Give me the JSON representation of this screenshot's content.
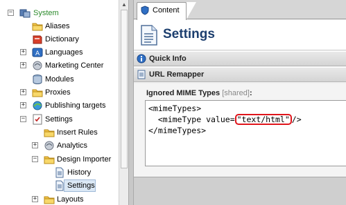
{
  "tree": {
    "items": [
      {
        "label": "System",
        "icon": "system-icon",
        "expander": "−"
      },
      {
        "label": "Aliases",
        "icon": "folder-icon",
        "expander": ""
      },
      {
        "label": "Dictionary",
        "icon": "dictionary-icon",
        "expander": ""
      },
      {
        "label": "Languages",
        "icon": "languages-icon",
        "expander": "+"
      },
      {
        "label": "Marketing Center",
        "icon": "marketing-center-icon",
        "expander": "+"
      },
      {
        "label": "Modules",
        "icon": "modules-icon",
        "expander": ""
      },
      {
        "label": "Proxies",
        "icon": "folder-icon",
        "expander": "+"
      },
      {
        "label": "Publishing targets",
        "icon": "publishing-targets-icon",
        "expander": "+"
      },
      {
        "label": "Settings",
        "icon": "settings-icon",
        "expander": "−"
      },
      {
        "label": "Insert Rules",
        "icon": "folder-icon",
        "expander": ""
      },
      {
        "label": "Analytics",
        "icon": "analytics-icon",
        "expander": "+"
      },
      {
        "label": "Design Importer",
        "icon": "folder-icon",
        "expander": "−"
      },
      {
        "label": "History",
        "icon": "document-icon",
        "expander": ""
      },
      {
        "label": "Settings",
        "icon": "document-icon",
        "expander": ""
      },
      {
        "label": "Layouts",
        "icon": "folder-icon",
        "expander": "+"
      }
    ]
  },
  "content": {
    "tab_label": "Content",
    "page_title": "Settings",
    "sections": {
      "quick_info": "Quick Info",
      "url_remapper": "URL Remapper"
    },
    "field": {
      "label": "Ignored MIME Types",
      "shared_tag": "[shared]",
      "colon": ":",
      "lines": {
        "l1": "<mimeTypes>",
        "l2_prefix": "  <mimeType value=",
        "l2_highlight": "\"text/html\"",
        "l2_suffix": "/>",
        "l3": "</mimeTypes>"
      }
    }
  },
  "colors": {
    "title": "#1c3e6e",
    "selection": "#dbe8f5",
    "highlight_ring": "#e0141b",
    "system_label": "#2a8a2a"
  }
}
